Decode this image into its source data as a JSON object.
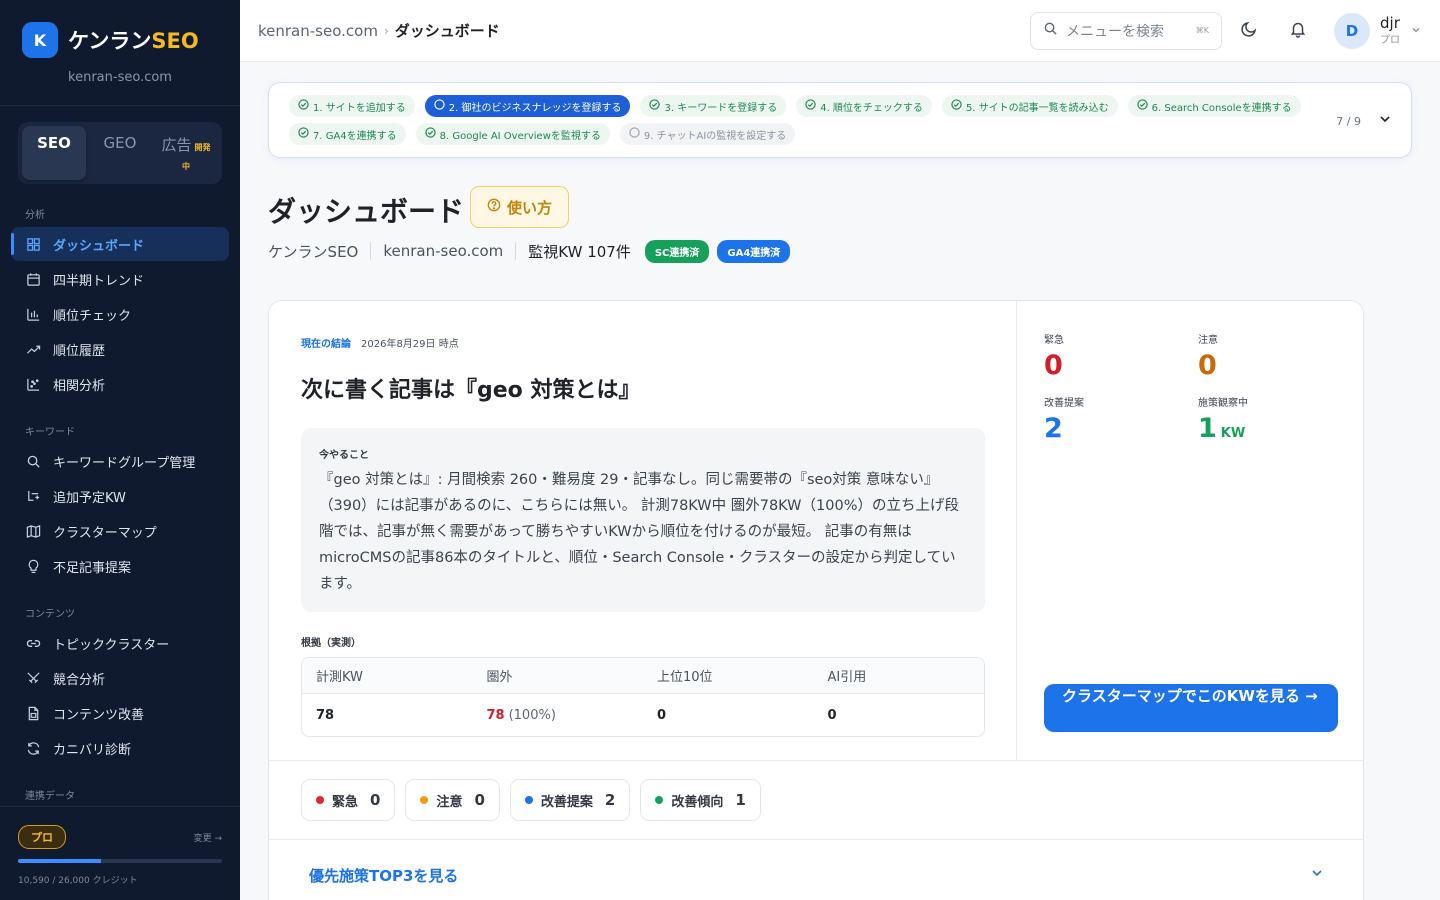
{
  "brand": {
    "logo_letter": "K",
    "name_main": "ケンラン",
    "name_accent": "SEO",
    "domain": "kenran-seo.com",
    "accent_color": "#f5b922"
  },
  "modes": [
    {
      "label": "SEO",
      "active": true
    },
    {
      "label": "GEO",
      "active": false
    },
    {
      "label": "広告",
      "badge1": "開発",
      "badge2": "中",
      "active": false
    }
  ],
  "nav": {
    "section_analysis": "分析",
    "analysis": [
      "ダッシュボード",
      "四半期トレンド",
      "順位チェック",
      "順位履歴",
      "相関分析"
    ],
    "section_keyword": "キーワード",
    "keyword": [
      "キーワードグループ管理",
      "追加予定KW",
      "クラスターマップ",
      "不足記事提案"
    ],
    "section_content": "コンテンツ",
    "content": [
      "トピッククラスター",
      "競合分析",
      "コンテンツ改善",
      "カニバリ診断"
    ],
    "section_data": "連携データ"
  },
  "plan": {
    "badge": "プロ",
    "change": "変更 →",
    "credit": "10,590 / 26,000 クレジット",
    "credit_used_fraction": 0.407
  },
  "topbar": {
    "crumb_site": "kenran-seo.com",
    "crumb_sep": "›",
    "crumb_current": "ダッシュボード",
    "search_placeholder": "メニューを検索",
    "search_kbd": "⌘K",
    "user_initial": "D",
    "user_name": "djr",
    "user_plan": "プロ"
  },
  "steps": {
    "items": [
      {
        "label": "1. サイトを追加する",
        "state": "done"
      },
      {
        "label": "2. 御社のビジネスナレッジを登録する",
        "state": "current"
      },
      {
        "label": "3. キーワードを登録する",
        "state": "done"
      },
      {
        "label": "4. 順位をチェックする",
        "state": "done"
      },
      {
        "label": "5. サイトの記事一覧を読み込む",
        "state": "done"
      },
      {
        "label": "6. Search Consoleを連携する",
        "state": "done"
      },
      {
        "label": "7. GA4を連携する",
        "state": "done"
      },
      {
        "label": "8. Google AI Overviewを監視する",
        "state": "done"
      },
      {
        "label": "9. チャットAIの監視を設定する",
        "state": "todo"
      }
    ],
    "count": "7 / 9"
  },
  "page": {
    "title": "ダッシュボード",
    "howto": "使い方",
    "meta_site": "ケンランSEO",
    "meta_domain": "kenran-seo.com",
    "meta_kw": "監視KW 107件",
    "pill_sc": "SC連携済",
    "pill_ga4": "GA4連携済"
  },
  "conclusion": {
    "label": "現在の結論",
    "date": "2026年8月29日 時点",
    "headline": "次に書く記事は『geo 対策とは』",
    "todo_label": "今やること",
    "todo_text": "『geo 対策とは』: 月間検索 260・難易度 29・記事なし。同じ需要帯の『seo対策 意味ない』（390）には記事があるのに、こちらには無い。 計測78KW中 圏外78KW（100%）の立ち上げ段階では、記事が無く需要があって勝ちやすいKWから順位を付けるのが最短。 記事の有無はmicroCMSの記事86本のタイトルと、順位・Search Console・クラスターの設定から判定しています。",
    "basis_label": "根拠（実測）",
    "table_headers": [
      "計測KW",
      "圏外",
      "上位10位",
      "AI引用"
    ],
    "table_values": {
      "measured": "78",
      "out": "78",
      "out_pct": "(100%)",
      "top10": "0",
      "ai": "0"
    }
  },
  "stats": {
    "urgent_label": "緊急",
    "urgent": "0",
    "caution_label": "注意",
    "caution": "0",
    "improve_label": "改善提案",
    "improve": "2",
    "observe_label": "施策観察中",
    "observe": "1",
    "observe_unit": "KW",
    "cta": "クラスターマップでこのKWを見る →"
  },
  "chips": [
    {
      "label": "緊急",
      "count": "0",
      "color": "#e0262f"
    },
    {
      "label": "注意",
      "count": "0",
      "color": "#f39c12"
    },
    {
      "label": "改善提案",
      "count": "2",
      "color": "#1c73ea"
    },
    {
      "label": "改善傾向",
      "count": "1",
      "color": "#17a05b"
    }
  ],
  "top3": "優先施策TOP3を見る"
}
